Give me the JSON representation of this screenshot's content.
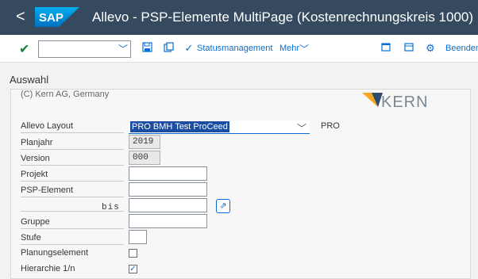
{
  "header": {
    "back_glyph": "<",
    "logo_text": "SAP",
    "title": "Allevo - PSP-Elemente MultiPage (Kostenrechnungskreis 1000)"
  },
  "toolbar": {
    "command_value": "",
    "status_label": "Statusmanagement",
    "more_label": "Mehr",
    "exit_label": "Beenden"
  },
  "section": {
    "title": "Auswahl"
  },
  "info": {
    "copyright": "(C) Kern AG, Germany",
    "logo_text": "KERN"
  },
  "fields": {
    "layout": {
      "label": "Allevo Layout",
      "value": "PRO BMH Test ProCeed",
      "suffix": "PRO"
    },
    "planjahr": {
      "label": "Planjahr",
      "value": "2019"
    },
    "version": {
      "label": "Version",
      "value": "000"
    },
    "projekt": {
      "label": "Projekt",
      "value": ""
    },
    "psp": {
      "label": "PSP-Element",
      "value": "",
      "to_label": "bis",
      "to_value": ""
    },
    "gruppe": {
      "label": "Gruppe",
      "value": ""
    },
    "stufe": {
      "label": "Stufe",
      "value": ""
    },
    "planungselement": {
      "label": "Planungselement",
      "checked": false
    },
    "hierarchie": {
      "label": "Hierarchie 1/n",
      "checked": true
    }
  },
  "colors": {
    "shell": "#354a5f",
    "accent": "#0a6ed1",
    "ok": "#1a7f37"
  },
  "icons": [
    "back-icon",
    "check-icon",
    "save-icon",
    "copy-icon",
    "status-icon",
    "chevron-down-icon",
    "new-window-icon",
    "layout-icon",
    "settings-icon",
    "multiple-selection-icon",
    "kern-logo"
  ]
}
